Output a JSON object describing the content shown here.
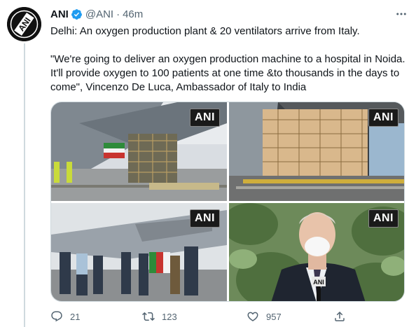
{
  "tweet": {
    "author_name": "ANI",
    "handle": "@ANI",
    "separator": "·",
    "time": "46m",
    "avatar_text": "ANI",
    "text_line1": "Delhi: An oxygen production plant & 20 ventilators arrive from Italy.",
    "text_line2": "\"We're going to deliver an oxygen production machine to a hospital in Noida. It'll provide oxygen to 100 patients at one time &to thousands in the days to come\", Vincenzo De Luca, Ambassador of Italy to India",
    "media": [
      {
        "watermark": "ANI"
      },
      {
        "watermark": "ANI"
      },
      {
        "watermark": "ANI"
      },
      {
        "watermark": "ANI",
        "mic_text": "ANI"
      }
    ],
    "actions": {
      "reply_count": "21",
      "retweet_count": "123",
      "like_count": "957"
    }
  },
  "colors": {
    "text_primary": "#0f1419",
    "text_secondary": "#536471",
    "verified": "#1d9bf0",
    "border": "#cfd9de"
  },
  "icons": [
    "verified-badge-icon",
    "more-icon",
    "reply-icon",
    "retweet-icon",
    "like-icon",
    "share-icon"
  ]
}
